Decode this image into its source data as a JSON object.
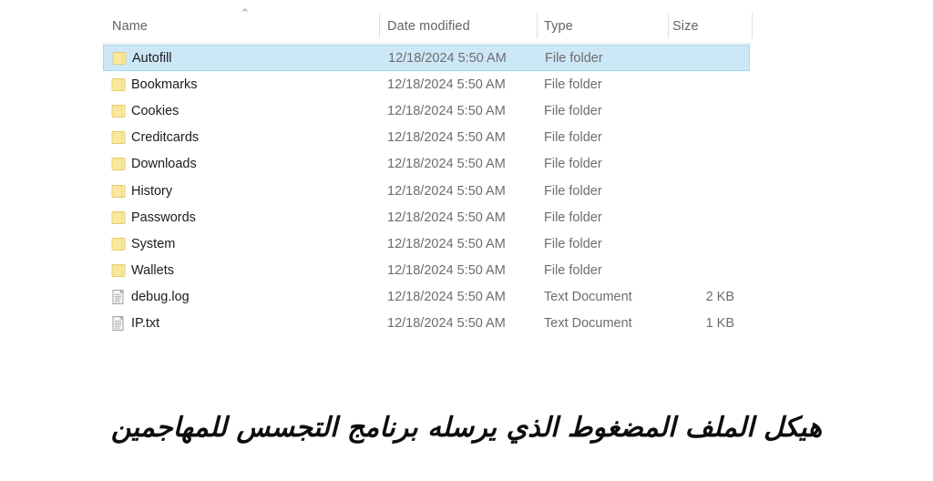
{
  "explorer": {
    "columns": [
      {
        "key": "name",
        "label": "Name"
      },
      {
        "key": "date",
        "label": "Date modified"
      },
      {
        "key": "type",
        "label": "Type"
      },
      {
        "key": "size",
        "label": "Size"
      }
    ],
    "sort": {
      "column": "Name",
      "direction": "ascending",
      "icon": "chevron-up-icon",
      "glyph": "⌃"
    },
    "selection": {
      "selected_row_index": 0,
      "highlight_color": "#cce8f7"
    },
    "colors": {
      "folder_icon": "#fbe8a0",
      "folder_icon_border": "#e6c96a",
      "document_icon": "#f4f4f4",
      "document_icon_border": "#9a9a9a",
      "selection": "#cce8f7",
      "selection_border": "#a8d8f0",
      "header_text": "#646464",
      "row_text": "#1c1c1c",
      "secondary_text": "#6d6d6d"
    },
    "rows": [
      {
        "icon": "folder-icon",
        "name": "Autofill",
        "date": "12/18/2024 5:50 AM",
        "type": "File folder",
        "size": "",
        "selected": true
      },
      {
        "icon": "folder-icon",
        "name": "Bookmarks",
        "date": "12/18/2024 5:50 AM",
        "type": "File folder",
        "size": "",
        "selected": false
      },
      {
        "icon": "folder-icon",
        "name": "Cookies",
        "date": "12/18/2024 5:50 AM",
        "type": "File folder",
        "size": "",
        "selected": false
      },
      {
        "icon": "folder-icon",
        "name": "Creditcards",
        "date": "12/18/2024 5:50 AM",
        "type": "File folder",
        "size": "",
        "selected": false
      },
      {
        "icon": "folder-icon",
        "name": "Downloads",
        "date": "12/18/2024 5:50 AM",
        "type": "File folder",
        "size": "",
        "selected": false
      },
      {
        "icon": "folder-icon",
        "name": "History",
        "date": "12/18/2024 5:50 AM",
        "type": "File folder",
        "size": "",
        "selected": false
      },
      {
        "icon": "folder-icon",
        "name": "Passwords",
        "date": "12/18/2024 5:50 AM",
        "type": "File folder",
        "size": "",
        "selected": false
      },
      {
        "icon": "folder-icon",
        "name": "System",
        "date": "12/18/2024 5:50 AM",
        "type": "File folder",
        "size": "",
        "selected": false
      },
      {
        "icon": "folder-icon",
        "name": "Wallets",
        "date": "12/18/2024 5:50 AM",
        "type": "File folder",
        "size": "",
        "selected": false
      },
      {
        "icon": "document-icon",
        "name": "debug.log",
        "date": "12/18/2024 5:50 AM",
        "type": "Text Document",
        "size": "2 KB",
        "selected": false
      },
      {
        "icon": "document-icon",
        "name": "IP.txt",
        "date": "12/18/2024 5:50 AM",
        "type": "Text Document",
        "size": "1 KB",
        "selected": false
      }
    ]
  },
  "caption": {
    "text": "هيكل الملف المضغوط الذي يرسله برنامج التجسس للمهاجمين"
  }
}
